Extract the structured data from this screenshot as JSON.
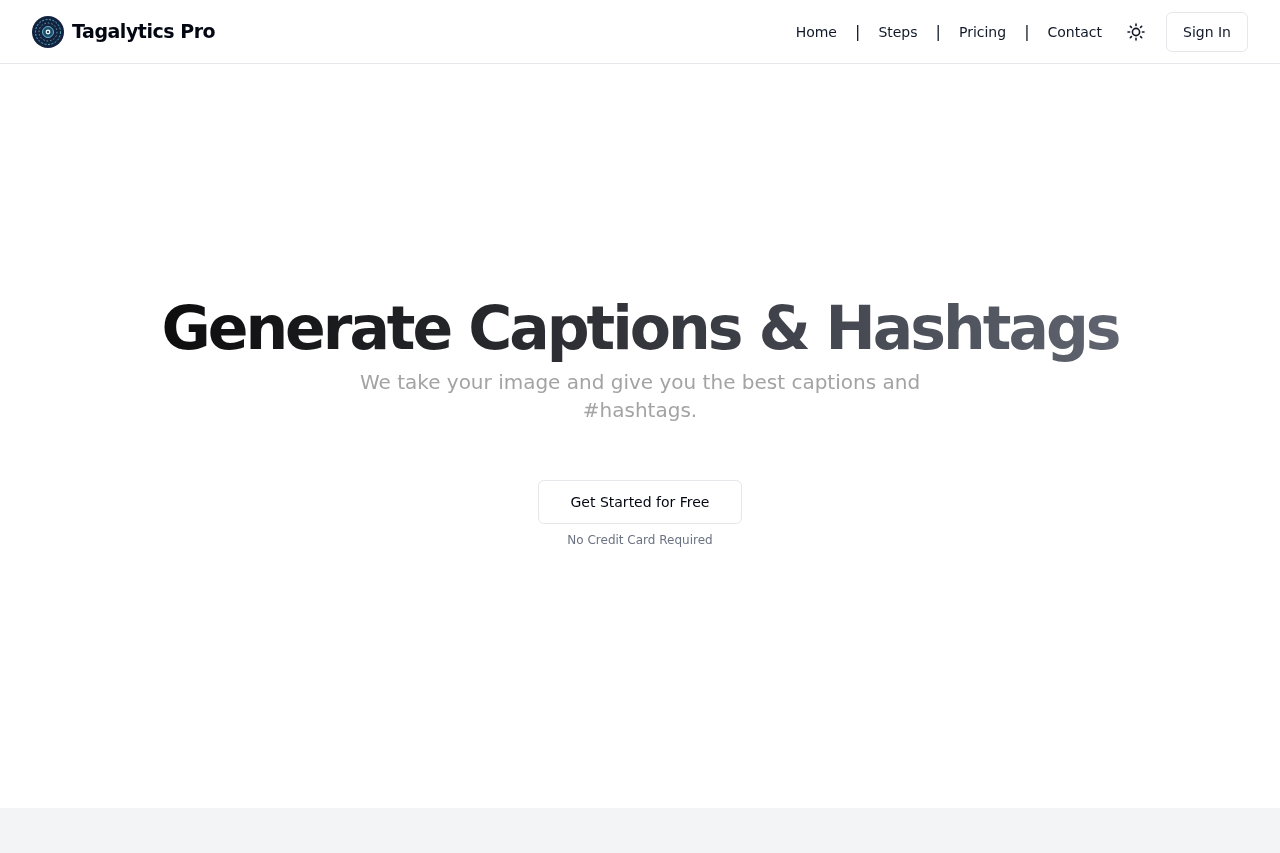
{
  "header": {
    "brand": {
      "name": "Tagalytics Pro"
    },
    "nav": [
      {
        "kind": "link",
        "label": "Home"
      },
      {
        "kind": "separator",
        "label": "|"
      },
      {
        "kind": "link",
        "label": "Steps"
      },
      {
        "kind": "separator",
        "label": "|"
      },
      {
        "kind": "link",
        "label": "Pricing"
      },
      {
        "kind": "separator",
        "label": "|"
      },
      {
        "kind": "link",
        "label": "Contact"
      }
    ],
    "theme_toggle": {
      "kind": "sun"
    },
    "sign_in": {
      "label": "Sign In"
    }
  },
  "hero": {
    "title": "Generate Captions & Hashtags",
    "subtitle": "We take your image and give you the best captions and #hashtags.",
    "cta": {
      "label": "Get Started for Free"
    },
    "note": "No Credit Card Required"
  }
}
